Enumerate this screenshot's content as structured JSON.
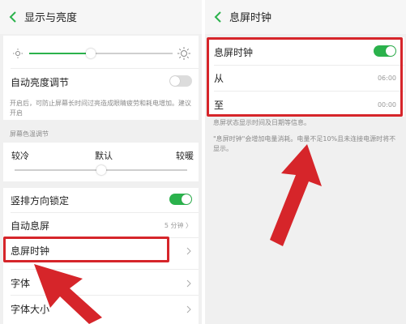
{
  "left": {
    "header_title": "显示与亮度",
    "auto_brightness": {
      "label": "自动亮度调节",
      "enabled": false
    },
    "auto_brightness_desc": "开启后，可防止屏幕长时间过亮造成眼睛疲劳和耗电增加。建议开启",
    "color_temp": {
      "section_label": "屏幕色温调节",
      "cool_label": "较冷",
      "default_label": "默认",
      "warm_label": "较暖",
      "level": 0.5
    },
    "brightness_level": 0.43,
    "portrait_lock": {
      "label": "竖排方向锁定",
      "enabled": true
    },
    "auto_sleep": {
      "label": "自动息屏",
      "value": "5 分钟 〉"
    },
    "aod_clock": {
      "label": "息屏时钟"
    },
    "font": {
      "label": "字体"
    },
    "font_size": {
      "label": "字体大小"
    }
  },
  "right": {
    "header_title": "息屏时钟",
    "aod_clock": {
      "label": "息屏时钟",
      "enabled": true
    },
    "from": {
      "label": "从",
      "value": "06:00"
    },
    "to": {
      "label": "至",
      "value": "00:00"
    },
    "desc1": "息屏状态显示时间及日期等信息。",
    "desc2": "\"息屏时钟\"会增加电量消耗。电量不足10%且未连接电源时将不显示。"
  },
  "colors": {
    "accent": "#2bb24c",
    "annotation_red": "#d6252a"
  }
}
